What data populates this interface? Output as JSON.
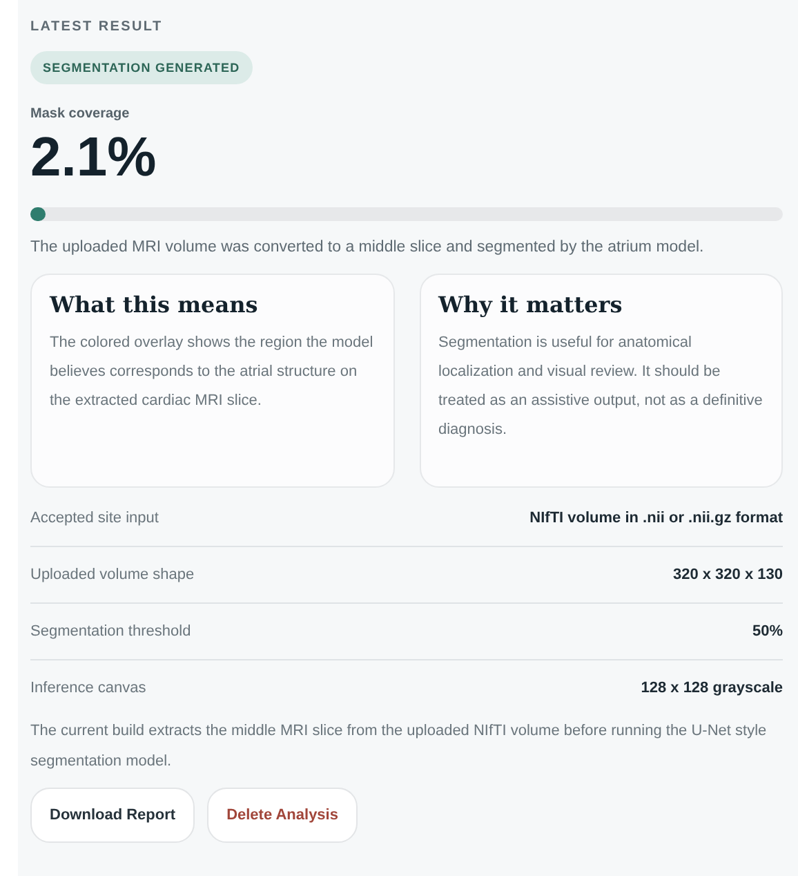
{
  "eyebrow": "LATEST RESULT",
  "badge": "SEGMENTATION GENERATED",
  "metric": {
    "label": "Mask coverage",
    "value": "2.1%",
    "level": 0.021
  },
  "summary": "The uploaded MRI volume was converted to a middle slice and segmented by the atrium model.",
  "cards": [
    {
      "title": "What this means",
      "body": "The colored overlay shows the region the model believes corresponds to the atrial structure on the extracted cardiac MRI slice."
    },
    {
      "title": "Why it matters",
      "body": "Segmentation is useful for anatomical localization and visual review. It should be treated as an assistive output, not as a definitive diagnosis."
    }
  ],
  "details": [
    {
      "label": "Accepted site input",
      "value": "NIfTI volume in .nii or .nii.gz format"
    },
    {
      "label": "Uploaded volume shape",
      "value": "320 x 320 x 130"
    },
    {
      "label": "Segmentation threshold",
      "value": "50%"
    },
    {
      "label": "Inference canvas",
      "value": "128 x 128 grayscale"
    }
  ],
  "note": "The current build extracts the middle MRI slice from the uploaded NIfTI volume before running the U-Net style segmentation model.",
  "buttons": [
    {
      "label": "Download Report",
      "kind": "default"
    },
    {
      "label": "Delete Analysis",
      "kind": "danger"
    }
  ]
}
